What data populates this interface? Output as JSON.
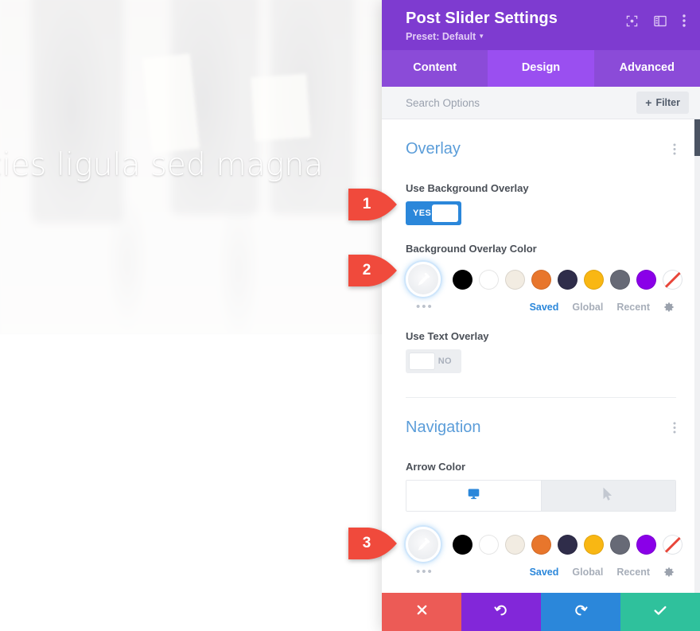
{
  "hero": {
    "title_text": "icies ligula sed magna"
  },
  "modal": {
    "title": "Post Slider Settings",
    "preset_label": "Preset: Default",
    "header_icons": [
      {
        "name": "fullscreen-icon"
      },
      {
        "name": "layout-panel-icon"
      },
      {
        "name": "kebab-menu-icon"
      }
    ],
    "tabs": [
      {
        "label": "Content",
        "active": false
      },
      {
        "label": "Design",
        "active": true
      },
      {
        "label": "Advanced",
        "active": false
      }
    ],
    "search": {
      "placeholder": "Search Options",
      "value": ""
    },
    "filter_button": {
      "label": "Filter",
      "plus": "+"
    }
  },
  "sections": [
    {
      "title": "Overlay",
      "fields": [
        {
          "label": "Use Background Overlay",
          "type": "toggle",
          "value": "YES",
          "state": "on"
        },
        {
          "label": "Background Overlay Color",
          "type": "color"
        }
      ]
    },
    {
      "title": "Navigation",
      "fields": [
        {
          "label": "Arrow Color",
          "type": "device-tabs-color"
        }
      ]
    }
  ],
  "toggles": {
    "background_overlay": {
      "label": "Use Background Overlay",
      "value": "YES"
    },
    "text_overlay": {
      "label": "Use Text Overlay",
      "value": "NO"
    }
  },
  "palette": {
    "swatches": [
      {
        "name": "black",
        "hex": "#000000"
      },
      {
        "name": "white",
        "hex": "#ffffff"
      },
      {
        "name": "cream",
        "hex": "#f2ece2"
      },
      {
        "name": "orange",
        "hex": "#e8762c"
      },
      {
        "name": "dark-navy",
        "hex": "#2f2d4a"
      },
      {
        "name": "amber",
        "hex": "#f9b713"
      },
      {
        "name": "slate-gray",
        "hex": "#676a76"
      },
      {
        "name": "violet",
        "hex": "#8a00e8"
      },
      {
        "name": "transparent",
        "hex": "none"
      }
    ],
    "links": [
      {
        "label": "Saved",
        "active": true
      },
      {
        "label": "Global",
        "active": false
      },
      {
        "label": "Recent",
        "active": false
      }
    ],
    "gear_icon": "gear-icon",
    "more_dots": "•••"
  },
  "navigation": {
    "section_title": "Navigation",
    "arrow_color_label": "Arrow Color",
    "device_tabs": [
      {
        "name": "desktop-icon",
        "active": true
      },
      {
        "name": "hover-cursor-icon",
        "active": false
      }
    ]
  },
  "footer": {
    "buttons": [
      {
        "name": "cancel-button",
        "icon": "close-icon",
        "color": "#ec5b56"
      },
      {
        "name": "undo-button",
        "icon": "undo-icon",
        "color": "#8227d9"
      },
      {
        "name": "redo-button",
        "icon": "redo-icon",
        "color": "#2b87da"
      },
      {
        "name": "save-button",
        "icon": "check-icon",
        "color": "#2fc19c"
      }
    ]
  },
  "callouts": [
    {
      "number": "1",
      "color": "#f04a3c"
    },
    {
      "number": "2",
      "color": "#f04a3c"
    },
    {
      "number": "3",
      "color": "#f04a3c"
    }
  ]
}
